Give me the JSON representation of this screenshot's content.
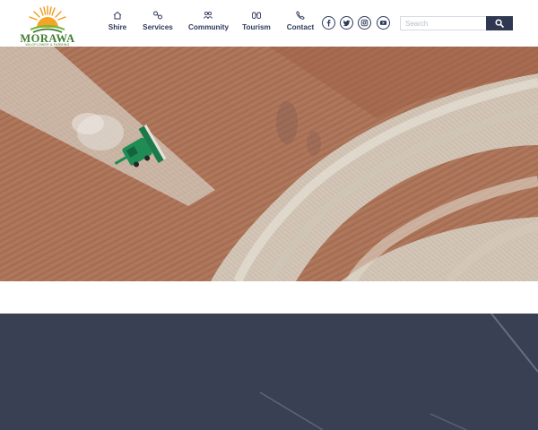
{
  "logo": {
    "wordmark": "MORAWA",
    "tagline": "WILDFLOWER & FARMING DISTRICT",
    "colors": {
      "sun": "#f5a524",
      "ray": "#f39a1b",
      "green": "#3e7c2f",
      "arc": "#79b843"
    }
  },
  "nav": {
    "items": [
      {
        "label": "Shire",
        "icon": "home-icon"
      },
      {
        "label": "Services",
        "icon": "services-icon"
      },
      {
        "label": "Community",
        "icon": "people-icon"
      },
      {
        "label": "Tourism",
        "icon": "binoculars-icon"
      },
      {
        "label": "Contact",
        "icon": "phone-icon"
      }
    ]
  },
  "social": [
    {
      "name": "facebook",
      "icon": "facebook-icon"
    },
    {
      "name": "twitter",
      "icon": "twitter-icon"
    },
    {
      "name": "instagram",
      "icon": "instagram-icon"
    },
    {
      "name": "youtube",
      "icon": "youtube-icon"
    }
  ],
  "search": {
    "placeholder": "Search",
    "value": "",
    "icon": "search-icon"
  },
  "hero": {
    "subject": "aerial-harvester-field",
    "colors": {
      "soil": "#a86f52",
      "stubble": "#d7d2c6",
      "harvester": "#1f8b55"
    }
  },
  "colors": {
    "navy": "#2e3a5c",
    "footer": "#394053",
    "search_button": "#2f3850"
  }
}
